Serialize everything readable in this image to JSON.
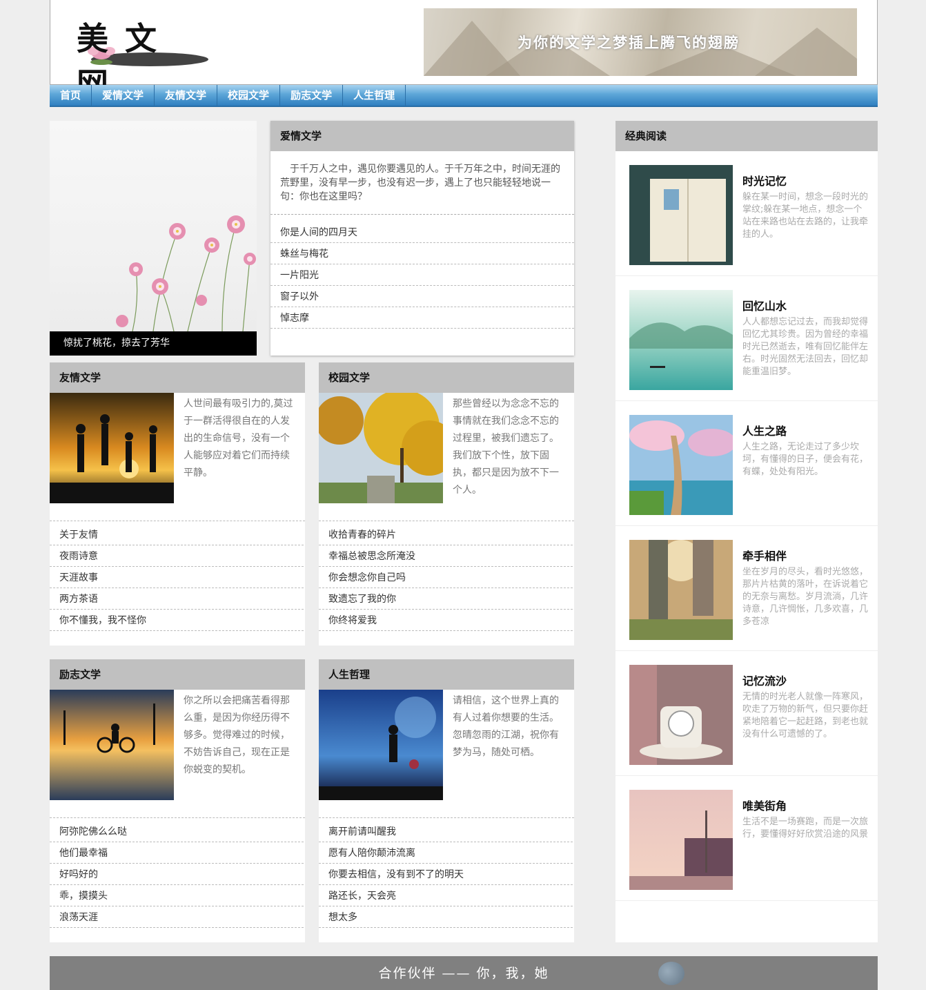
{
  "header": {
    "logo_text": "美文网",
    "banner_slogan": "为你的文学之梦插上腾飞的翅膀"
  },
  "nav": {
    "items": [
      "首页",
      "爱情文学",
      "友情文学",
      "校园文学",
      "励志文学",
      "人生哲理"
    ]
  },
  "feature": {
    "caption": "惊扰了桃花，掠去了芳华"
  },
  "love": {
    "title": "爱情文学",
    "intro": "于千万人之中，遇见你要遇见的人。于千万年之中，时间无涯的荒野里，没有早一步，也没有迟一步，遇上了也只能轻轻地说一句：你也在这里吗？",
    "links": [
      "你是人间的四月天",
      "蛛丝与梅花",
      "一片阳光",
      "窗子以外",
      "悼志摩"
    ]
  },
  "friendship": {
    "title": "友情文学",
    "desc": "人世间最有吸引力的,莫过于一群活得很自在的人发出的生命信号，没有一个人能够应对着它们而持续平静。",
    "links": [
      "关于友情",
      "夜雨诗意",
      "天涯故事",
      "两方茶语",
      "你不懂我，我不怪你"
    ]
  },
  "campus": {
    "title": "校园文学",
    "desc": "那些曾经以为念念不忘的事情就在我们念念不忘的过程里，被我们遗忘了。我们放下个性，放下固执，都只是因为放不下一个人。",
    "links": [
      "收拾青春的碎片",
      "幸福总被思念所淹没",
      "你会想念你自己吗",
      "致遗忘了我的你",
      "你终将爱我"
    ]
  },
  "inspire": {
    "title": "励志文学",
    "desc": "你之所以会把痛苦看得那么重，是因为你经历得不够多。觉得难过的时候，不妨告诉自己，现在正是你蜕变的契机。",
    "links": [
      "阿弥陀佛么么哒",
      "他们最幸福",
      "好吗好的",
      "乖，摸摸头",
      "浪荡天涯"
    ]
  },
  "philosophy": {
    "title": "人生哲理",
    "desc": "请相信，这个世界上真的有人过着你想要的生活。忽晴忽雨的江湖，祝你有梦为马，随处可栖。",
    "links": [
      "离开前请叫醒我",
      "愿有人陪你颠沛流离",
      "你要去相信，没有到不了的明天",
      "路还长，天会亮",
      "想太多"
    ]
  },
  "sidebar": {
    "title": "经典阅读",
    "items": [
      {
        "title": "时光记忆",
        "desc": "躲在某一时间，想念一段时光的掌纹;躲在某一地点，想念一个站在来路也站在去路的，让我牵挂的人。"
      },
      {
        "title": "回忆山水",
        "desc": "人人都想忘记过去，而我却觉得回忆尤其珍贵。因为曾经的幸福时光已然逝去，唯有回忆能伴左右。时光固然无法回去，回忆却能重温旧梦。"
      },
      {
        "title": "人生之路",
        "desc": "人生之路，无论走过了多少坎坷，有懂得的日子，便会有花，有蝶，处处有阳光。"
      },
      {
        "title": "牵手相伴",
        "desc": "坐在岁月的尽头，看时光悠悠，那片片枯黄的落叶，在诉说着它的无奈与离愁。岁月流淌，几许诗意，几许惆怅，几多欢喜，几多苍凉"
      },
      {
        "title": "记忆流沙",
        "desc": "无情的时光老人就像一阵寒风，吹走了万物的新气，但只要你赶紧地陪着它一起赶路，到老也就没有什么可遗憾的了。"
      },
      {
        "title": "唯美街角",
        "desc": "生活不是一场赛跑，而是一次旅行，要懂得好好欣赏沿途的风景"
      }
    ]
  },
  "footer": {
    "text": "合作伙伴 —— 你，我，她"
  }
}
